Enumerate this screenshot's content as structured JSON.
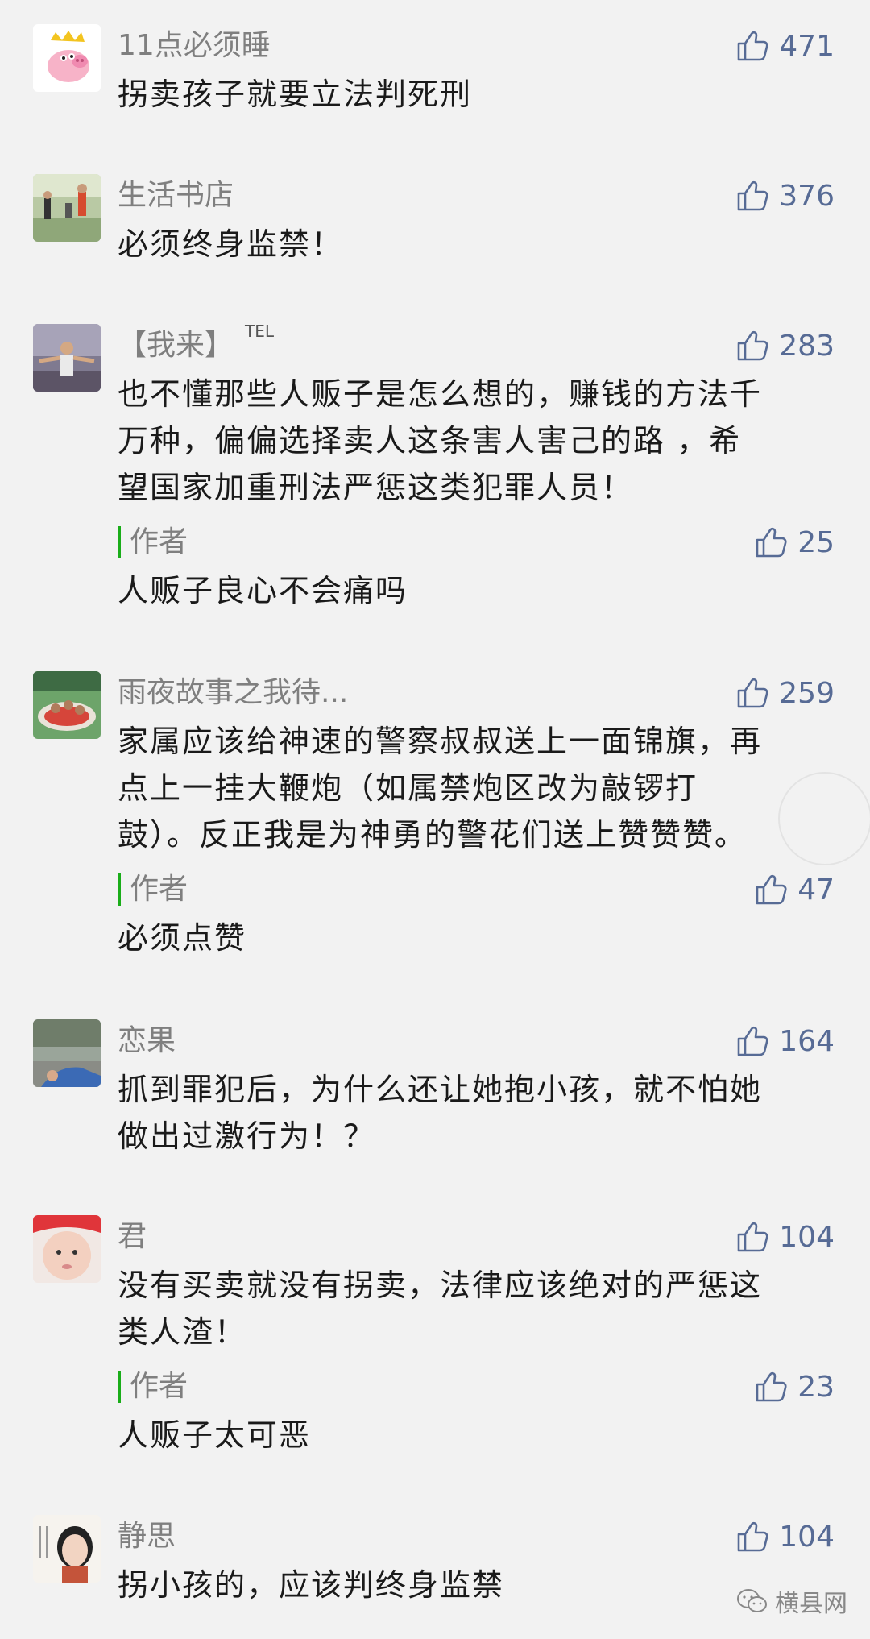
{
  "colors": {
    "background": "#f2f2f2",
    "nickname": "#7f7f7f",
    "like_blue": "#576b95",
    "author_green": "#1aad19",
    "text": "#1a1a1a"
  },
  "icons": {
    "like": "thumbs-up-icon",
    "watermark": "wechat-icon"
  },
  "comments": [
    {
      "nickname": "11点必须睡",
      "likes": "471",
      "text": "拐卖孩子就要立法判死刑"
    },
    {
      "nickname": "生活书店",
      "likes": "376",
      "text": "必须终身监禁！"
    },
    {
      "nickname": "【我来】",
      "nickname_tag": "TEL",
      "likes": "283",
      "text_lines": [
        "也不懂那些人贩子是怎么想的，赚钱的方法千",
        "万种，偏偏选择卖人这条害人害己的路 ，希",
        "望国家加重刑法严惩这类犯罪人员！"
      ],
      "reply": {
        "label": "作者",
        "likes": "25",
        "text": "人贩子良心不会痛吗"
      }
    },
    {
      "nickname": "雨夜故事之我待...",
      "likes": "259",
      "text_lines": [
        "家属应该给神速的警察叔叔送上一面锦旗，再",
        "点上一挂大鞭炮（如属禁炮区改为敲锣打",
        "鼓）。反正我是为神勇的警花们送上赞赞赞。"
      ],
      "reply": {
        "label": "作者",
        "likes": "47",
        "text": "必须点赞"
      }
    },
    {
      "nickname": "恋果",
      "likes": "164",
      "text_lines": [
        "抓到罪犯后，为什么还让她抱小孩，就不怕她",
        "做出过激行为！？"
      ]
    },
    {
      "nickname": "君",
      "likes": "104",
      "text_lines": [
        "没有买卖就没有拐卖，法律应该绝对的严惩这",
        "类人渣！"
      ],
      "reply": {
        "label": "作者",
        "likes": "23",
        "text": "人贩子太可恶"
      }
    },
    {
      "nickname": "静思",
      "likes": "104",
      "text": "拐小孩的，应该判终身监禁"
    }
  ],
  "watermark": {
    "text": "横县网"
  }
}
